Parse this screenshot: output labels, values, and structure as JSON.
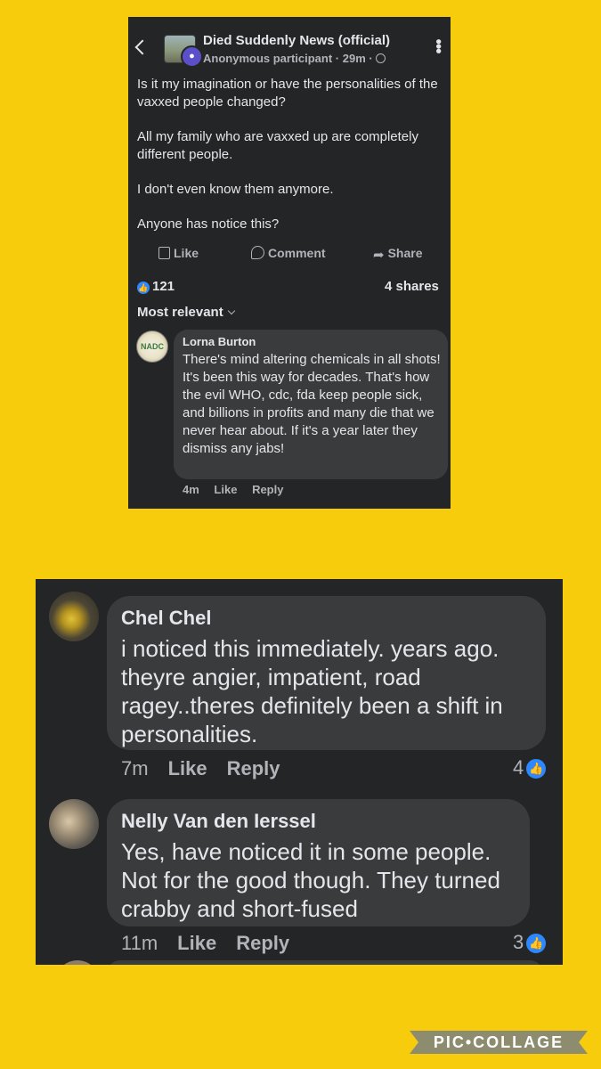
{
  "post": {
    "group_name": "Died Suddenly News (official)",
    "author": "Anonymous participant",
    "time": "29m",
    "paragraphs": [
      "Is it my imagination or have the personalities of the vaxxed people changed?",
      "All my family who are vaxxed up are completely different people.",
      "I don't even know them anymore.",
      "Anyone has notice this?"
    ],
    "actions": {
      "like": "Like",
      "comment": "Comment",
      "share": "Share"
    },
    "reaction_count": "121",
    "shares": "4 shares",
    "sort_label": "Most relevant"
  },
  "comment_lorna": {
    "name": "Lorna Burton",
    "text": "There's mind altering chemicals in all shots!  It's been this way for decades. That's how the evil WHO, cdc, fda keep people sick, and billions in profits and many die that we never hear about. If it's a year later they dismiss any jabs!",
    "time": "4m",
    "like": "Like",
    "reply": "Reply"
  },
  "comments2": [
    {
      "name": "Chel Chel",
      "text": "i noticed this immediately. years ago. theyre angier, impatient, road ragey..theres definitely been a shift in personalities.",
      "time": "7m",
      "like": "Like",
      "reply": "Reply",
      "likes": "4"
    },
    {
      "name": "Nelly Van den Ierssel",
      "text": "Yes, have noticed it in some people. Not for the good though. They turned crabby and short-fused",
      "time": "11m",
      "like": "Like",
      "reply": "Reply",
      "likes": "3"
    }
  ],
  "watermark": "PIC•COLLAGE",
  "colors": {
    "background": "#f7cc0c",
    "panel": "#242526",
    "bubble": "#3a3b3c",
    "like_blue": "#2d88ff",
    "anon_badge": "#5b50c9"
  },
  "icons": [
    "back-chevron-icon",
    "anonymous-icon",
    "globe-icon",
    "more-options-icon",
    "thumbs-up-icon",
    "comment-icon",
    "share-arrow-icon",
    "like-reaction-icon",
    "chevron-down-icon"
  ]
}
